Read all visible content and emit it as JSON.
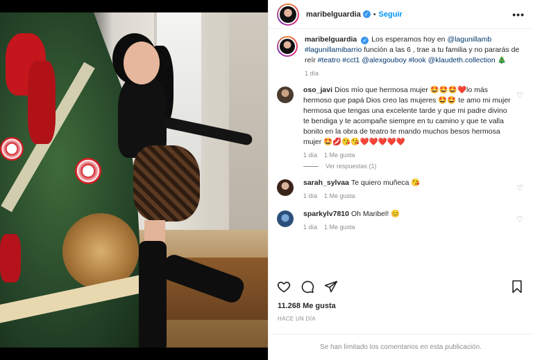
{
  "post": {
    "username": "maribelguardia",
    "follow_label": "Seguir",
    "separator": "•",
    "more_label": "•••"
  },
  "caption": {
    "username": "maribelguardia",
    "text_1": "Los esperamos hoy en ",
    "mention_1": "@lagunillamb",
    "hashtag_1": "#lagunillamibarrio",
    "text_2": " función a las 6 , trae a tu familia y no pararás de reír ",
    "hashtag_2": "#teatro",
    "hashtag_3": "#cct1",
    "mention_2": "@alexgouboy",
    "hashtag_4": "#look",
    "mention_3": "@klaudeth.collection",
    "emoji": "🎄",
    "time": "1 día"
  },
  "comments": [
    {
      "username": "oso_javi",
      "text": "Dios mío que hermosa mujer 🤩🤩🤩❤️lo más hermoso que papá Dios creo las mujeres 🤩🤩 te amo mi mujer hermosa que tengas una excelente tarde y que mi padre divino te bendiga y te acompañe siempre en tu camino y que te valla bonito en la obra de teatro te mando muchos besos hermosa mujer 🤩💋😘😘❤️❤️❤️❤️❤️",
      "time": "1 día",
      "likes": "1 Me gusta",
      "view_replies": "Ver respuestas (1)"
    },
    {
      "username": "sarah_sylvaa",
      "text": "Te quiero muñeca 😘",
      "time": "1 día",
      "likes": "1 Me gusta"
    },
    {
      "username": "sparkylv7810",
      "text": "Oh Maribel! 😊",
      "time": "1 día",
      "likes": "1 Me gusta"
    }
  ],
  "footer": {
    "likes": "11.268 Me gusta",
    "posted_ago": "HACE UN DÍA",
    "limited_notice": "Se han limitado los comentarios en esta publicación."
  },
  "icons": {
    "verified": "✓",
    "heart": "♡"
  },
  "colors": {
    "link": "#00376b",
    "follow": "#0095f6",
    "verified": "#3897f0",
    "meta": "#8e8e8e"
  }
}
